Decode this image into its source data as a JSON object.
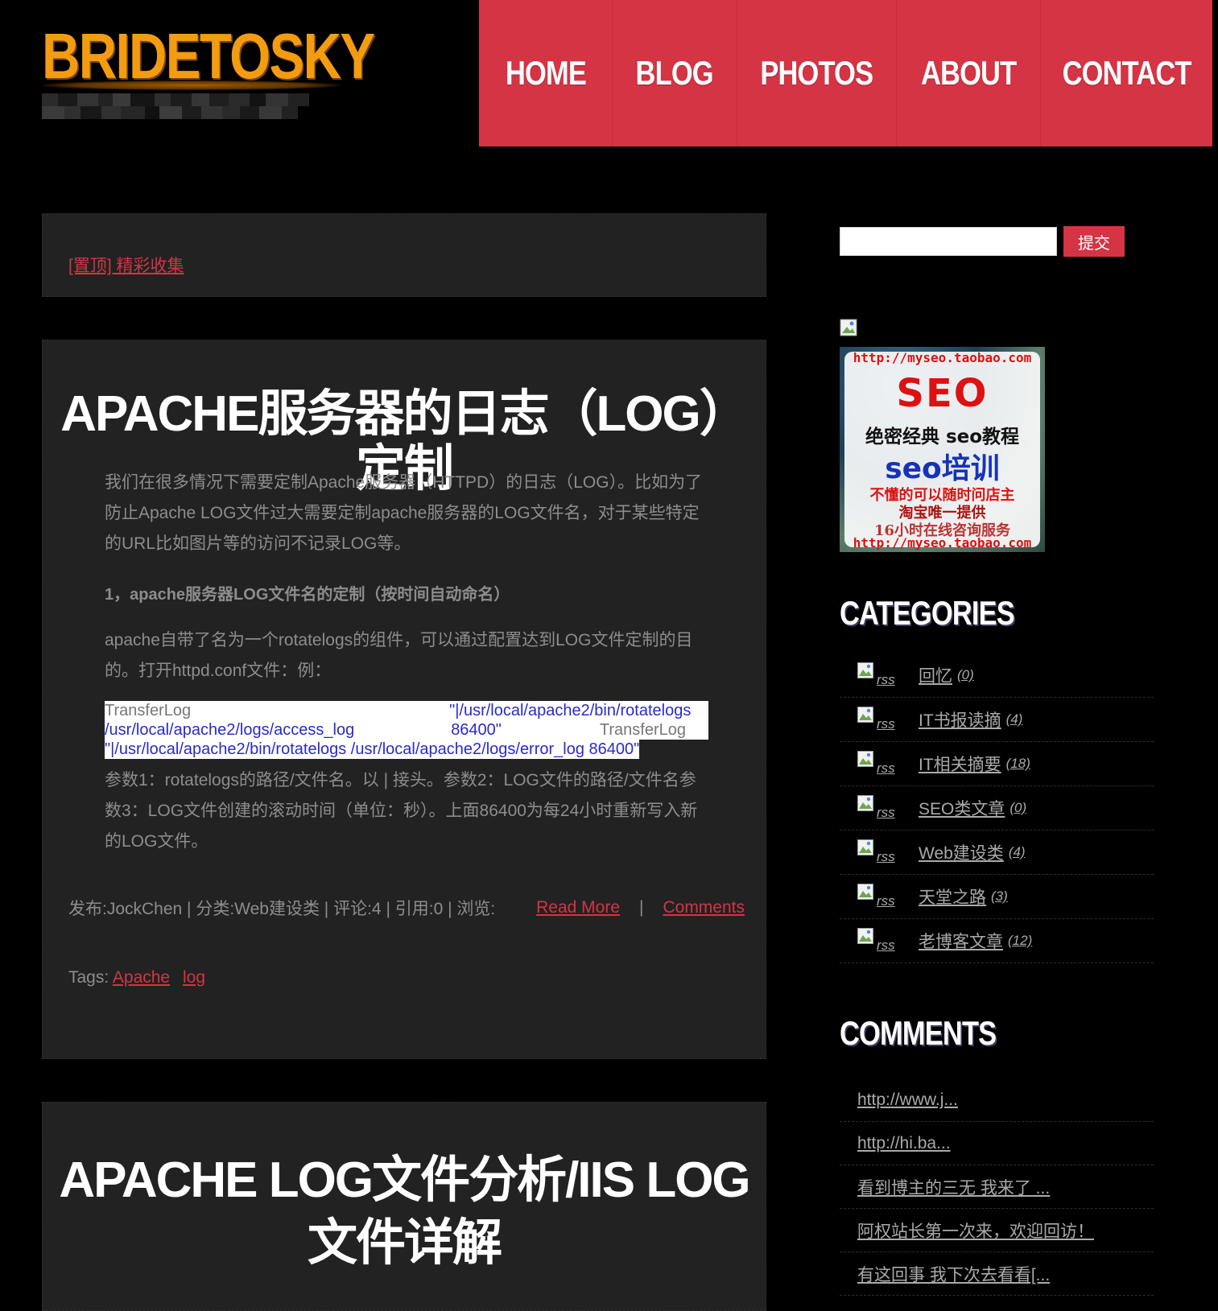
{
  "site": {
    "title": "BRIDETOSKY"
  },
  "nav": {
    "items": [
      "HOME",
      "BLOG",
      "PHOTOS",
      "ABOUT",
      "CONTACT"
    ]
  },
  "sticky": {
    "link": "[置顶] 精彩收集"
  },
  "post1": {
    "title": "APACHE服务器的日志（LOG）定制",
    "paragraph1": "我们在很多情况下需要定制Apache服务器（HTTPD）的日志（LOG）。比如为了防止Apache LOG文件过大需要定制apache服务器的LOG文件名，对于某些特定的URL比如图片等的访问不记录LOG等。",
    "heading1": "1，apache服务器LOG文件名的定制（按时间自动命名）",
    "paragraph2": "apache自带了名为一个rotatelogs的组件，可以通过配置达到LOG文件定制的目的。打开httpd.conf文件：例：",
    "code": {
      "l1_gray": "TransferLog",
      "l1_blue": "\"|/usr/local/apache2/bin/rotatelogs",
      "l2_blue": "/usr/local/apache2/logs/access_log",
      "l2_num": "86400\"",
      "l2_gray": "TransferLog",
      "l3_blue": "\"|/usr/local/apache2/bin/rotatelogs /usr/local/apache2/logs/error_log 86400\""
    },
    "paragraph3": "参数1：rotatelogs的路径/文件名。以 | 接头。参数2：LOG文件的路径/文件名参数3：LOG文件创建的滚动时间（单位：秒）。上面86400为每24小时重新写入新的LOG文件。",
    "meta": "发布:JockChen | 分类:Web建设类 | 评论:4 | 引用:0 | 浏览:",
    "read_more": "Read More",
    "separator": "|",
    "comments_link": "Comments",
    "tags_label": "Tags:",
    "tags": [
      "Apache",
      "log"
    ]
  },
  "post2": {
    "title": "APACHE LOG文件分析/IIS LOG文件详解"
  },
  "sidebar": {
    "search_button": "提交",
    "ad": {
      "url": "http://myseo.taobao.com",
      "seo": "SEO",
      "line1": "绝密经典 seo教程",
      "line2": "seo培训",
      "line3": "不懂的可以随时问店主",
      "line4": "淘宝唯一提供",
      "line5": "16小时在线咨询服务"
    },
    "categories_heading": "CATEGORIES",
    "rss_alt": "rss",
    "categories": [
      {
        "name": "回忆",
        "count": "(0)"
      },
      {
        "name": "IT书报读摘",
        "count": "(4)"
      },
      {
        "name": "IT相关摘要",
        "count": "(18)"
      },
      {
        "name": "SEO类文章",
        "count": "(0)"
      },
      {
        "name": "Web建设类",
        "count": "(4)"
      },
      {
        "name": "天堂之路",
        "count": "(3)"
      },
      {
        "name": "老博客文章",
        "count": "(12)"
      }
    ],
    "comments_heading": "COMMENTS",
    "comments": [
      "http://www.j...",
      "http://hi.ba...",
      "看到博主的三无 我来了 ...",
      "阿权站长第一次来，欢迎回访！",
      "有这回事 我下次去看看[..."
    ]
  },
  "colors": {
    "accent_red": "#d43444",
    "title_orange": "#f39c12",
    "panel_bg": "#222222",
    "page_bg": "#000000"
  }
}
